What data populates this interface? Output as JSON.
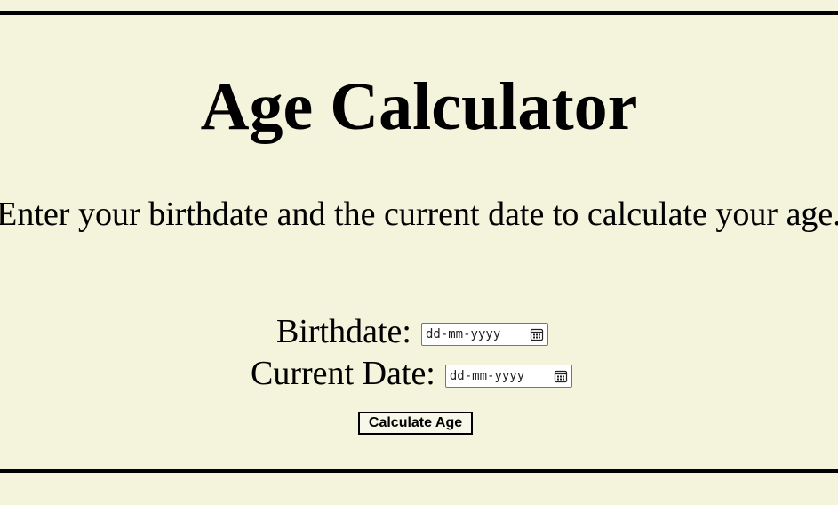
{
  "header": {
    "title": "Age Calculator"
  },
  "intro": {
    "text": "Enter your birthdate and the current date to calculate your age."
  },
  "form": {
    "birthdate": {
      "label": "Birthdate:",
      "placeholder": "dd-mm-yyyy",
      "value": ""
    },
    "current_date": {
      "label": "Current Date:",
      "placeholder": "dd-mm-yyyy",
      "value": ""
    },
    "submit_label": "Calculate Age"
  },
  "icons": {
    "date_picker": "calendar-icon"
  },
  "colors": {
    "background": "#f4f4dc",
    "border": "#000000",
    "text": "#000000"
  }
}
